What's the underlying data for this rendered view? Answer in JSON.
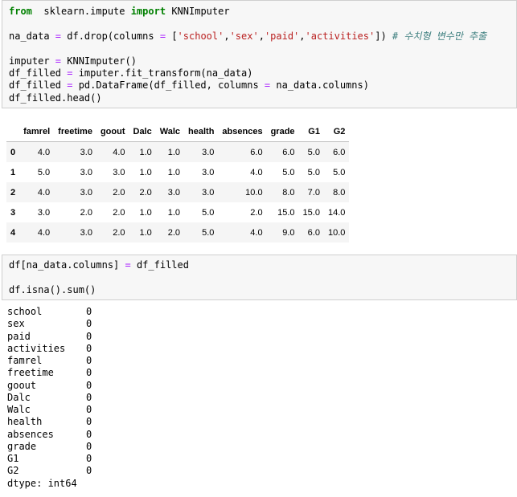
{
  "cell1": {
    "lines": [
      [
        [
          "kw",
          "from"
        ],
        [
          "",
          "  sklearn.impute "
        ],
        [
          "kw",
          "import"
        ],
        [
          "",
          " KNNImputer"
        ]
      ],
      [],
      [
        [
          "",
          "na_data "
        ],
        [
          "op",
          "="
        ],
        [
          "",
          " df.drop(columns "
        ],
        [
          "op",
          "="
        ],
        [
          "",
          " ["
        ],
        [
          "str",
          "'school'"
        ],
        [
          "",
          ","
        ],
        [
          "str",
          "'sex'"
        ],
        [
          "",
          ","
        ],
        [
          "str",
          "'paid'"
        ],
        [
          "",
          ","
        ],
        [
          "str",
          "'activities'"
        ],
        [
          "",
          "]) "
        ],
        [
          "cm",
          "# 수치형 변수만 추출"
        ]
      ],
      [],
      [
        [
          "",
          "imputer "
        ],
        [
          "op",
          "="
        ],
        [
          "",
          " KNNImputer()"
        ]
      ],
      [
        [
          "",
          "df_filled "
        ],
        [
          "op",
          "="
        ],
        [
          "",
          " imputer.fit_transform(na_data)"
        ]
      ],
      [
        [
          "",
          "df_filled "
        ],
        [
          "op",
          "="
        ],
        [
          "",
          " pd.DataFrame(df_filled, columns "
        ],
        [
          "op",
          "="
        ],
        [
          "",
          " na_data.columns)"
        ]
      ],
      [
        [
          "",
          "df_filled.head()"
        ]
      ]
    ]
  },
  "dataframe": {
    "columns": [
      "",
      "famrel",
      "freetime",
      "goout",
      "Dalc",
      "Walc",
      "health",
      "absences",
      "grade",
      "G1",
      "G2"
    ],
    "rows": [
      [
        "0",
        "4.0",
        "3.0",
        "4.0",
        "1.0",
        "1.0",
        "3.0",
        "6.0",
        "6.0",
        "5.0",
        "6.0"
      ],
      [
        "1",
        "5.0",
        "3.0",
        "3.0",
        "1.0",
        "1.0",
        "3.0",
        "4.0",
        "5.0",
        "5.0",
        "5.0"
      ],
      [
        "2",
        "4.0",
        "3.0",
        "2.0",
        "2.0",
        "3.0",
        "3.0",
        "10.0",
        "8.0",
        "7.0",
        "8.0"
      ],
      [
        "3",
        "3.0",
        "2.0",
        "2.0",
        "1.0",
        "1.0",
        "5.0",
        "2.0",
        "15.0",
        "15.0",
        "14.0"
      ],
      [
        "4",
        "4.0",
        "3.0",
        "2.0",
        "1.0",
        "2.0",
        "5.0",
        "4.0",
        "9.0",
        "6.0",
        "10.0"
      ]
    ]
  },
  "cell2": {
    "lines": [
      [
        [
          "",
          "df[na_data.columns] "
        ],
        [
          "op",
          "="
        ],
        [
          "",
          " df_filled"
        ]
      ],
      [],
      [
        [
          "",
          "df.isna().sum()"
        ]
      ]
    ]
  },
  "output": {
    "rows": [
      [
        "school",
        "0"
      ],
      [
        "sex",
        "0"
      ],
      [
        "paid",
        "0"
      ],
      [
        "activities",
        "0"
      ],
      [
        "famrel",
        "0"
      ],
      [
        "freetime",
        "0"
      ],
      [
        "goout",
        "0"
      ],
      [
        "Dalc",
        "0"
      ],
      [
        "Walc",
        "0"
      ],
      [
        "health",
        "0"
      ],
      [
        "absences",
        "0"
      ],
      [
        "grade",
        "0"
      ],
      [
        "G1",
        "0"
      ],
      [
        "G2",
        "0"
      ]
    ],
    "dtype": "dtype: int64"
  }
}
